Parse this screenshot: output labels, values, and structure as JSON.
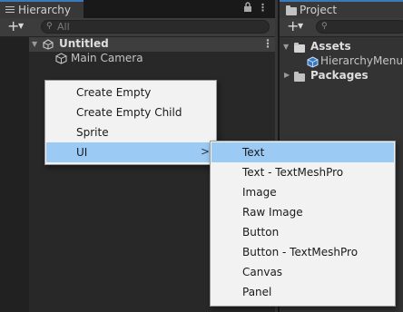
{
  "hierarchy": {
    "tab_label": "Hierarchy",
    "lock_icon": "lock-icon",
    "menu_glyph": "⋮",
    "search_placeholder": "All",
    "scene_name": "Untitled",
    "items": [
      "Main Camera"
    ]
  },
  "project": {
    "tab_label": "Project",
    "tree": {
      "assets_label": "Assets",
      "asset_item": "HierarchyMenuS",
      "packages_label": "Packages"
    }
  },
  "context_menu": {
    "items": [
      "Create Empty",
      "Create Empty Child",
      "Sprite",
      "UI"
    ],
    "submenu_arrow": ">"
  },
  "ui_submenu": {
    "items": [
      "Text",
      "Text - TextMeshPro",
      "Image",
      "Raw Image",
      "Button",
      "Button - TextMeshPro",
      "Canvas",
      "Panel"
    ]
  },
  "colors": {
    "highlight": "#9bcaf5",
    "tab_accent": "#3a79bb",
    "menu_bg": "#f2f2f2"
  }
}
